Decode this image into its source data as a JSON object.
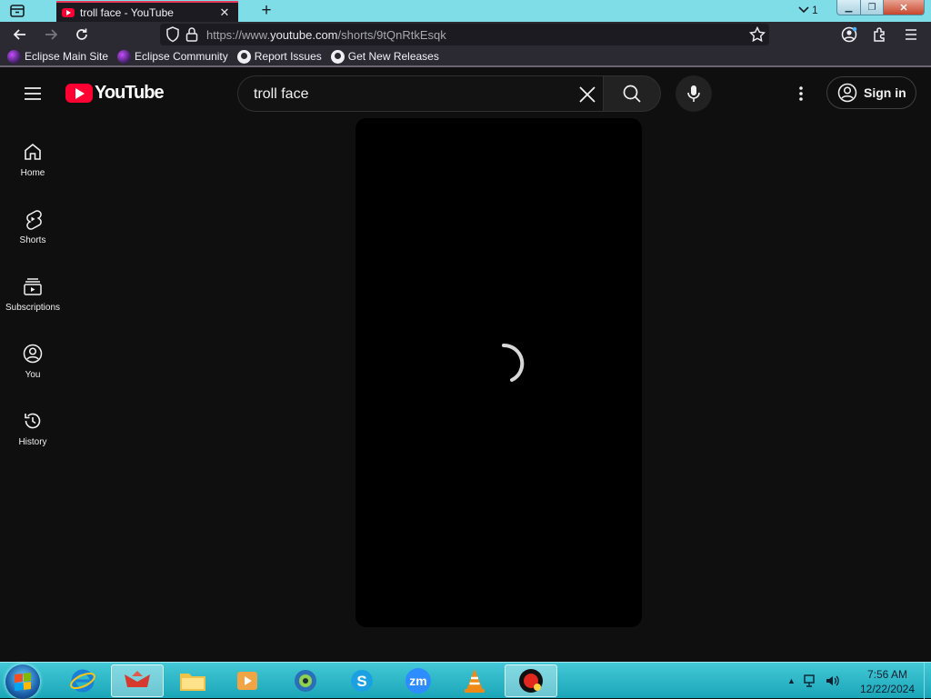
{
  "browser": {
    "tab_title": "troll face - YouTube",
    "tab_counter": "1",
    "url_prefix": "https://www.",
    "url_host": "youtube.com",
    "url_path": "/shorts/9tQnRtkEsqk",
    "bookmarks": [
      {
        "label": "Eclipse Main Site",
        "icon": "eclipse-icon"
      },
      {
        "label": "Eclipse Community",
        "icon": "eclipse-icon"
      },
      {
        "label": "Report Issues",
        "icon": "github-icon"
      },
      {
        "label": "Get New Releases",
        "icon": "github-icon"
      }
    ]
  },
  "youtube": {
    "logo_text": "YouTube",
    "search_query": "troll face",
    "signin_label": "Sign in",
    "sidebar": [
      {
        "label": "Home",
        "icon": "home-icon"
      },
      {
        "label": "Shorts",
        "icon": "shorts-icon"
      },
      {
        "label": "Subscriptions",
        "icon": "subscriptions-icon"
      },
      {
        "label": "You",
        "icon": "you-icon"
      },
      {
        "label": "History",
        "icon": "history-icon"
      }
    ],
    "player_state": "loading"
  },
  "taskbar": {
    "apps": [
      "internet-explorer",
      "gaming-app",
      "file-explorer",
      "media-player",
      "network-app",
      "skype",
      "zoom",
      "vlc",
      "recorder"
    ],
    "active_app": "recorder",
    "clock_time": "7:56 AM",
    "clock_date": "12/22/2024"
  },
  "colors": {
    "tab_accent": "#e33b5c",
    "youtube_red": "#ff0033",
    "page_background": "#0f0f0f",
    "taskbar": "#1aa6b8"
  }
}
